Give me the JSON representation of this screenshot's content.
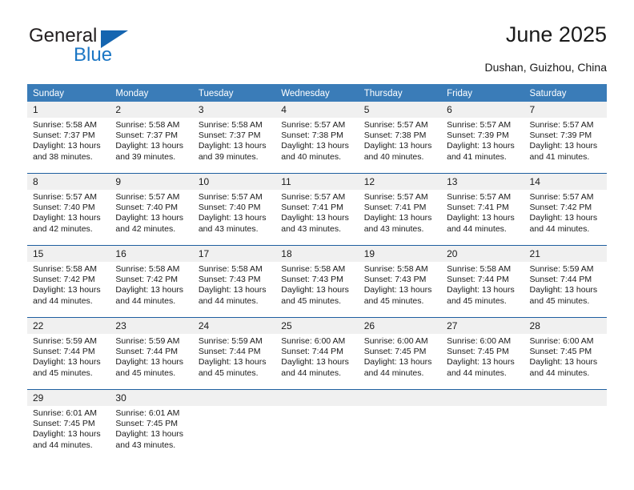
{
  "logo": {
    "word_top": "General",
    "word_bottom": "Blue",
    "triangle_icon": "triangle-icon",
    "color_dark": "#231f20",
    "color_blue": "#1b76c4"
  },
  "header": {
    "title": "June 2025",
    "subtitle": "Dushan, Guizhou, China"
  },
  "theme": {
    "header_bg": "#3a7cb8",
    "header_text": "#ffffff",
    "row_divider": "#1f5fa0",
    "day_band_bg": "#f0f0f0",
    "cell_bg": "#ffffff",
    "text": "#1a1a1a"
  },
  "calendar": {
    "weekdays": [
      "Sunday",
      "Monday",
      "Tuesday",
      "Wednesday",
      "Thursday",
      "Friday",
      "Saturday"
    ],
    "weeks": [
      [
        {
          "day": "1",
          "sunrise": "Sunrise: 5:58 AM",
          "sunset": "Sunset: 7:37 PM",
          "daylight1": "Daylight: 13 hours",
          "daylight2": "and 38 minutes."
        },
        {
          "day": "2",
          "sunrise": "Sunrise: 5:58 AM",
          "sunset": "Sunset: 7:37 PM",
          "daylight1": "Daylight: 13 hours",
          "daylight2": "and 39 minutes."
        },
        {
          "day": "3",
          "sunrise": "Sunrise: 5:58 AM",
          "sunset": "Sunset: 7:37 PM",
          "daylight1": "Daylight: 13 hours",
          "daylight2": "and 39 minutes."
        },
        {
          "day": "4",
          "sunrise": "Sunrise: 5:57 AM",
          "sunset": "Sunset: 7:38 PM",
          "daylight1": "Daylight: 13 hours",
          "daylight2": "and 40 minutes."
        },
        {
          "day": "5",
          "sunrise": "Sunrise: 5:57 AM",
          "sunset": "Sunset: 7:38 PM",
          "daylight1": "Daylight: 13 hours",
          "daylight2": "and 40 minutes."
        },
        {
          "day": "6",
          "sunrise": "Sunrise: 5:57 AM",
          "sunset": "Sunset: 7:39 PM",
          "daylight1": "Daylight: 13 hours",
          "daylight2": "and 41 minutes."
        },
        {
          "day": "7",
          "sunrise": "Sunrise: 5:57 AM",
          "sunset": "Sunset: 7:39 PM",
          "daylight1": "Daylight: 13 hours",
          "daylight2": "and 41 minutes."
        }
      ],
      [
        {
          "day": "8",
          "sunrise": "Sunrise: 5:57 AM",
          "sunset": "Sunset: 7:40 PM",
          "daylight1": "Daylight: 13 hours",
          "daylight2": "and 42 minutes."
        },
        {
          "day": "9",
          "sunrise": "Sunrise: 5:57 AM",
          "sunset": "Sunset: 7:40 PM",
          "daylight1": "Daylight: 13 hours",
          "daylight2": "and 42 minutes."
        },
        {
          "day": "10",
          "sunrise": "Sunrise: 5:57 AM",
          "sunset": "Sunset: 7:40 PM",
          "daylight1": "Daylight: 13 hours",
          "daylight2": "and 43 minutes."
        },
        {
          "day": "11",
          "sunrise": "Sunrise: 5:57 AM",
          "sunset": "Sunset: 7:41 PM",
          "daylight1": "Daylight: 13 hours",
          "daylight2": "and 43 minutes."
        },
        {
          "day": "12",
          "sunrise": "Sunrise: 5:57 AM",
          "sunset": "Sunset: 7:41 PM",
          "daylight1": "Daylight: 13 hours",
          "daylight2": "and 43 minutes."
        },
        {
          "day": "13",
          "sunrise": "Sunrise: 5:57 AM",
          "sunset": "Sunset: 7:41 PM",
          "daylight1": "Daylight: 13 hours",
          "daylight2": "and 44 minutes."
        },
        {
          "day": "14",
          "sunrise": "Sunrise: 5:57 AM",
          "sunset": "Sunset: 7:42 PM",
          "daylight1": "Daylight: 13 hours",
          "daylight2": "and 44 minutes."
        }
      ],
      [
        {
          "day": "15",
          "sunrise": "Sunrise: 5:58 AM",
          "sunset": "Sunset: 7:42 PM",
          "daylight1": "Daylight: 13 hours",
          "daylight2": "and 44 minutes."
        },
        {
          "day": "16",
          "sunrise": "Sunrise: 5:58 AM",
          "sunset": "Sunset: 7:42 PM",
          "daylight1": "Daylight: 13 hours",
          "daylight2": "and 44 minutes."
        },
        {
          "day": "17",
          "sunrise": "Sunrise: 5:58 AM",
          "sunset": "Sunset: 7:43 PM",
          "daylight1": "Daylight: 13 hours",
          "daylight2": "and 44 minutes."
        },
        {
          "day": "18",
          "sunrise": "Sunrise: 5:58 AM",
          "sunset": "Sunset: 7:43 PM",
          "daylight1": "Daylight: 13 hours",
          "daylight2": "and 45 minutes."
        },
        {
          "day": "19",
          "sunrise": "Sunrise: 5:58 AM",
          "sunset": "Sunset: 7:43 PM",
          "daylight1": "Daylight: 13 hours",
          "daylight2": "and 45 minutes."
        },
        {
          "day": "20",
          "sunrise": "Sunrise: 5:58 AM",
          "sunset": "Sunset: 7:44 PM",
          "daylight1": "Daylight: 13 hours",
          "daylight2": "and 45 minutes."
        },
        {
          "day": "21",
          "sunrise": "Sunrise: 5:59 AM",
          "sunset": "Sunset: 7:44 PM",
          "daylight1": "Daylight: 13 hours",
          "daylight2": "and 45 minutes."
        }
      ],
      [
        {
          "day": "22",
          "sunrise": "Sunrise: 5:59 AM",
          "sunset": "Sunset: 7:44 PM",
          "daylight1": "Daylight: 13 hours",
          "daylight2": "and 45 minutes."
        },
        {
          "day": "23",
          "sunrise": "Sunrise: 5:59 AM",
          "sunset": "Sunset: 7:44 PM",
          "daylight1": "Daylight: 13 hours",
          "daylight2": "and 45 minutes."
        },
        {
          "day": "24",
          "sunrise": "Sunrise: 5:59 AM",
          "sunset": "Sunset: 7:44 PM",
          "daylight1": "Daylight: 13 hours",
          "daylight2": "and 45 minutes."
        },
        {
          "day": "25",
          "sunrise": "Sunrise: 6:00 AM",
          "sunset": "Sunset: 7:44 PM",
          "daylight1": "Daylight: 13 hours",
          "daylight2": "and 44 minutes."
        },
        {
          "day": "26",
          "sunrise": "Sunrise: 6:00 AM",
          "sunset": "Sunset: 7:45 PM",
          "daylight1": "Daylight: 13 hours",
          "daylight2": "and 44 minutes."
        },
        {
          "day": "27",
          "sunrise": "Sunrise: 6:00 AM",
          "sunset": "Sunset: 7:45 PM",
          "daylight1": "Daylight: 13 hours",
          "daylight2": "and 44 minutes."
        },
        {
          "day": "28",
          "sunrise": "Sunrise: 6:00 AM",
          "sunset": "Sunset: 7:45 PM",
          "daylight1": "Daylight: 13 hours",
          "daylight2": "and 44 minutes."
        }
      ],
      [
        {
          "day": "29",
          "sunrise": "Sunrise: 6:01 AM",
          "sunset": "Sunset: 7:45 PM",
          "daylight1": "Daylight: 13 hours",
          "daylight2": "and 44 minutes."
        },
        {
          "day": "30",
          "sunrise": "Sunrise: 6:01 AM",
          "sunset": "Sunset: 7:45 PM",
          "daylight1": "Daylight: 13 hours",
          "daylight2": "and 43 minutes."
        },
        {
          "day": "",
          "sunrise": "",
          "sunset": "",
          "daylight1": "",
          "daylight2": ""
        },
        {
          "day": "",
          "sunrise": "",
          "sunset": "",
          "daylight1": "",
          "daylight2": ""
        },
        {
          "day": "",
          "sunrise": "",
          "sunset": "",
          "daylight1": "",
          "daylight2": ""
        },
        {
          "day": "",
          "sunrise": "",
          "sunset": "",
          "daylight1": "",
          "daylight2": ""
        },
        {
          "day": "",
          "sunrise": "",
          "sunset": "",
          "daylight1": "",
          "daylight2": ""
        }
      ]
    ]
  }
}
